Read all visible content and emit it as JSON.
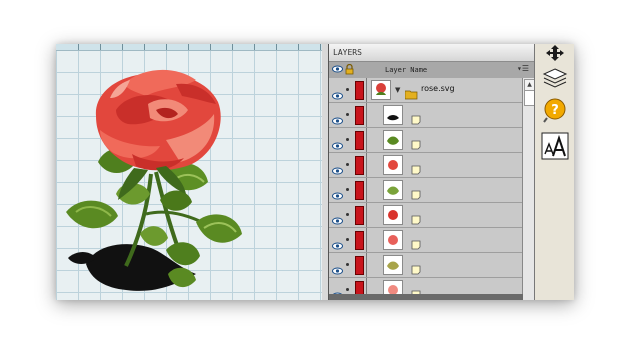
{
  "panel": {
    "title": "LAYERS",
    "header_label": "Layer Name",
    "menu_icon": "panel-menu-icon"
  },
  "layers": [
    {
      "name": "rose.svg",
      "type": "group",
      "visible": true,
      "color": "#c8141c",
      "thumb": "rose"
    },
    {
      "name": "",
      "type": "object",
      "visible": true,
      "color": "#c8141c",
      "thumb": "dark-shadow"
    },
    {
      "name": "",
      "type": "object",
      "visible": true,
      "color": "#c8141c",
      "thumb": "green-leaves"
    },
    {
      "name": "",
      "type": "object",
      "visible": true,
      "color": "#c8141c",
      "thumb": "red-petals"
    },
    {
      "name": "",
      "type": "object",
      "visible": true,
      "color": "#c8141c",
      "thumb": "green-leaves"
    },
    {
      "name": "",
      "type": "object",
      "visible": true,
      "color": "#c8141c",
      "thumb": "red-petals"
    },
    {
      "name": "",
      "type": "object",
      "visible": true,
      "color": "#c8141c",
      "thumb": "red-petals"
    },
    {
      "name": "",
      "type": "object",
      "visible": true,
      "color": "#c8141c",
      "thumb": "olive-leaves"
    },
    {
      "name": "",
      "type": "object",
      "visible": true,
      "color": "#c8141c",
      "thumb": "pink-petals"
    }
  ],
  "toolbar": {
    "tools": [
      "move-arrows-icon",
      "layers-icon",
      "help-icon",
      "text-size-icon"
    ]
  },
  "colors": {
    "layer_color": "#c8141c",
    "canvas_bg": "#e8f0f2",
    "panel_bg": "#bdbdbd"
  }
}
